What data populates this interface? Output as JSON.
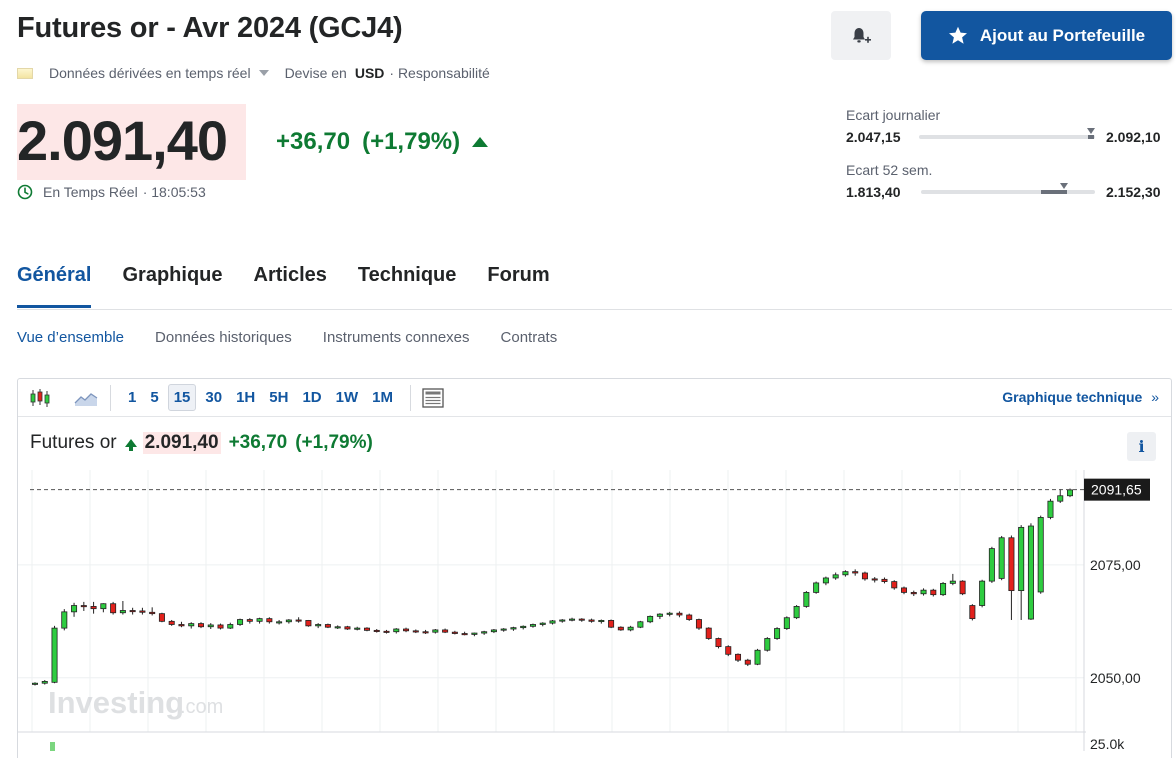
{
  "header": {
    "title": "Futures or - Avr 2024 (GCJ4)",
    "data_mode": "Données dérivées en temps réel",
    "currency_label": "Devise en",
    "currency": "USD",
    "responsibility": "· Responsabilité",
    "portfolio_button": "Ajout au Portefeuille"
  },
  "quote": {
    "last": "2.091,40",
    "change": "+36,70",
    "change_pct": "(+1,79%)",
    "realtime_label": "En Temps Réel",
    "time": "· 18:05:53"
  },
  "ranges": {
    "daily": {
      "label": "Ecart journalier",
      "low": "2.047,15",
      "high": "2.092,10",
      "position": 0.98
    },
    "year": {
      "label": "Ecart 52 sem.",
      "low": "1.813,40",
      "high": "2.152,30",
      "position": 0.82
    }
  },
  "tabs": [
    "Général",
    "Graphique",
    "Articles",
    "Technique",
    "Forum"
  ],
  "active_tab": 0,
  "subtabs": [
    "Vue d’ensemble",
    "Données historiques",
    "Instruments connexes",
    "Contrats"
  ],
  "chart_toolbar": {
    "intervals": [
      "1",
      "5",
      "15",
      "30",
      "1H",
      "5H",
      "1D",
      "1W",
      "1M"
    ],
    "active_interval": "15",
    "tech_link": "Graphique technique",
    "tech_link_arrow": "»"
  },
  "chart_header": {
    "name": "Futures or",
    "last": "2.091,40",
    "change": "+36,70",
    "change_pct": "(+1,79%)",
    "info": "i"
  },
  "watermark": {
    "brand": "Investing",
    "suffix": ".com"
  },
  "colors": {
    "up": "#2ecc40",
    "down": "#e2211c",
    "accent": "#1256a0",
    "positive_text": "#0e7a33"
  },
  "chart_data": {
    "type": "candlestick",
    "ylim": [
      2038,
      2096
    ],
    "y_ticks": [
      "2075,00",
      "2050,00"
    ],
    "y_tick_values": [
      2075,
      2050
    ],
    "last_marker": "2091,65",
    "last_value": 2091.65,
    "volume_tick": "25.0k",
    "candles": [
      [
        2048.6,
        2049.0,
        2048.3,
        2048.8
      ],
      [
        2048.8,
        2049.5,
        2048.5,
        2049.2
      ],
      [
        2049.0,
        2061.5,
        2048.8,
        2061.0
      ],
      [
        2061.0,
        2065.2,
        2060.5,
        2064.6
      ],
      [
        2064.6,
        2066.6,
        2063.5,
        2066.0
      ],
      [
        2066.0,
        2066.8,
        2064.8,
        2065.8
      ],
      [
        2065.8,
        2066.8,
        2064.2,
        2065.3
      ],
      [
        2065.3,
        2066.5,
        2064.5,
        2066.4
      ],
      [
        2066.4,
        2066.8,
        2064.0,
        2064.4
      ],
      [
        2064.4,
        2067.0,
        2064.0,
        2064.9
      ],
      [
        2064.9,
        2065.5,
        2064.0,
        2064.8
      ],
      [
        2064.8,
        2065.5,
        2064.0,
        2064.5
      ],
      [
        2064.5,
        2065.6,
        2063.8,
        2064.2
      ],
      [
        2064.2,
        2064.4,
        2062.3,
        2062.5
      ],
      [
        2062.5,
        2062.8,
        2061.5,
        2061.8
      ],
      [
        2061.8,
        2062.4,
        2061.2,
        2061.5
      ],
      [
        2061.5,
        2062.3,
        2060.9,
        2062.0
      ],
      [
        2062.0,
        2062.3,
        2061.0,
        2061.3
      ],
      [
        2061.3,
        2062.1,
        2060.8,
        2061.7
      ],
      [
        2061.7,
        2062.0,
        2060.7,
        2061.0
      ],
      [
        2061.0,
        2062.2,
        2060.8,
        2061.8
      ],
      [
        2061.8,
        2063.1,
        2061.5,
        2062.9
      ],
      [
        2062.9,
        2063.2,
        2062.0,
        2062.5
      ],
      [
        2062.5,
        2063.3,
        2062.0,
        2063.1
      ],
      [
        2063.1,
        2063.4,
        2062.0,
        2062.4
      ],
      [
        2062.4,
        2062.8,
        2061.8,
        2062.4
      ],
      [
        2062.4,
        2063.0,
        2062.0,
        2062.8
      ],
      [
        2062.8,
        2063.4,
        2062.2,
        2062.7
      ],
      [
        2062.7,
        2062.8,
        2061.3,
        2061.5
      ],
      [
        2061.5,
        2062.1,
        2061.0,
        2061.8
      ],
      [
        2061.8,
        2062.0,
        2061.0,
        2061.2
      ],
      [
        2061.2,
        2061.6,
        2060.8,
        2061.3
      ],
      [
        2061.3,
        2061.5,
        2060.6,
        2060.8
      ],
      [
        2060.8,
        2061.3,
        2060.5,
        2061.0
      ],
      [
        2061.0,
        2061.2,
        2060.3,
        2060.5
      ],
      [
        2060.5,
        2060.8,
        2060.0,
        2060.3
      ],
      [
        2060.3,
        2060.6,
        2059.8,
        2060.2
      ],
      [
        2060.2,
        2061.0,
        2059.8,
        2060.8
      ],
      [
        2060.8,
        2061.1,
        2060.1,
        2060.4
      ],
      [
        2060.4,
        2060.7,
        2059.9,
        2060.2
      ],
      [
        2060.2,
        2060.6,
        2059.7,
        2060.1
      ],
      [
        2060.1,
        2060.8,
        2059.8,
        2060.6
      ],
      [
        2060.6,
        2060.9,
        2059.9,
        2060.1
      ],
      [
        2060.1,
        2060.4,
        2059.6,
        2059.8
      ],
      [
        2059.8,
        2060.2,
        2059.4,
        2059.6
      ],
      [
        2059.6,
        2060.0,
        2059.2,
        2059.9
      ],
      [
        2059.9,
        2060.4,
        2059.5,
        2060.2
      ],
      [
        2060.2,
        2060.8,
        2059.9,
        2060.6
      ],
      [
        2060.6,
        2061.0,
        2060.2,
        2060.8
      ],
      [
        2060.8,
        2061.3,
        2060.4,
        2061.1
      ],
      [
        2061.1,
        2061.6,
        2060.7,
        2061.4
      ],
      [
        2061.4,
        2062.0,
        2061.1,
        2061.8
      ],
      [
        2061.8,
        2062.3,
        2061.4,
        2062.1
      ],
      [
        2062.1,
        2062.8,
        2061.8,
        2062.6
      ],
      [
        2062.6,
        2063.0,
        2062.2,
        2062.8
      ],
      [
        2062.8,
        2063.3,
        2062.5,
        2063.0
      ],
      [
        2063.0,
        2063.2,
        2062.4,
        2062.8
      ],
      [
        2062.8,
        2063.1,
        2062.2,
        2062.5
      ],
      [
        2062.5,
        2062.9,
        2062.0,
        2062.7
      ],
      [
        2062.7,
        2062.9,
        2061.0,
        2061.2
      ],
      [
        2061.2,
        2061.4,
        2060.4,
        2060.6
      ],
      [
        2060.6,
        2061.5,
        2060.3,
        2061.2
      ],
      [
        2061.2,
        2062.6,
        2061.0,
        2062.4
      ],
      [
        2062.4,
        2063.8,
        2062.1,
        2063.6
      ],
      [
        2063.6,
        2064.3,
        2063.0,
        2064.1
      ],
      [
        2064.1,
        2064.6,
        2063.6,
        2064.3
      ],
      [
        2064.3,
        2064.7,
        2063.4,
        2063.9
      ],
      [
        2063.9,
        2064.2,
        2062.6,
        2062.9
      ],
      [
        2062.9,
        2063.1,
        2060.6,
        2061.0
      ],
      [
        2061.0,
        2061.2,
        2058.4,
        2058.7
      ],
      [
        2058.7,
        2058.9,
        2056.5,
        2056.9
      ],
      [
        2056.9,
        2057.2,
        2054.8,
        2055.2
      ],
      [
        2055.2,
        2055.4,
        2053.5,
        2053.9
      ],
      [
        2053.9,
        2054.2,
        2052.6,
        2053.0
      ],
      [
        2053.0,
        2056.4,
        2052.8,
        2056.1
      ],
      [
        2056.1,
        2059.0,
        2055.8,
        2058.7
      ],
      [
        2058.7,
        2061.2,
        2058.4,
        2060.9
      ],
      [
        2060.9,
        2063.6,
        2060.6,
        2063.3
      ],
      [
        2063.3,
        2066.1,
        2063.0,
        2065.8
      ],
      [
        2065.8,
        2069.2,
        2065.5,
        2068.9
      ],
      [
        2068.9,
        2071.3,
        2068.6,
        2071.0
      ],
      [
        2071.0,
        2072.4,
        2070.5,
        2072.1
      ],
      [
        2072.1,
        2073.3,
        2071.7,
        2072.8
      ],
      [
        2072.8,
        2073.8,
        2072.4,
        2073.5
      ],
      [
        2073.5,
        2074.0,
        2072.6,
        2073.2
      ],
      [
        2073.2,
        2073.5,
        2071.5,
        2071.9
      ],
      [
        2071.9,
        2072.3,
        2071.1,
        2071.8
      ],
      [
        2071.8,
        2072.2,
        2070.9,
        2071.3
      ],
      [
        2071.3,
        2071.6,
        2069.5,
        2069.9
      ],
      [
        2069.9,
        2070.2,
        2068.5,
        2068.9
      ],
      [
        2068.9,
        2069.3,
        2068.1,
        2068.6
      ],
      [
        2068.6,
        2069.8,
        2068.2,
        2069.4
      ],
      [
        2069.4,
        2069.7,
        2068.0,
        2068.4
      ],
      [
        2068.4,
        2071.2,
        2068.1,
        2070.9
      ],
      [
        2070.9,
        2073.0,
        2070.5,
        2071.4
      ],
      [
        2071.4,
        2071.6,
        2068.3,
        2068.6
      ],
      [
        2066.0,
        2066.3,
        2062.7,
        2063.1
      ],
      [
        2066.0,
        2071.7,
        2065.6,
        2071.4
      ],
      [
        2071.4,
        2079.0,
        2071.0,
        2078.6
      ],
      [
        2072.0,
        2081.4,
        2071.6,
        2081.0
      ],
      [
        2081.0,
        2081.5,
        2062.8,
        2069.3
      ],
      [
        2069.3,
        2083.8,
        2062.8,
        2083.3
      ],
      [
        2063.0,
        2084.2,
        2062.8,
        2083.6
      ],
      [
        2069.0,
        2085.9,
        2068.6,
        2085.5
      ],
      [
        2085.5,
        2089.6,
        2085.1,
        2089.1
      ],
      [
        2089.1,
        2091.8,
        2088.7,
        2090.3
      ],
      [
        2090.3,
        2091.9,
        2090.0,
        2091.6
      ]
    ]
  }
}
